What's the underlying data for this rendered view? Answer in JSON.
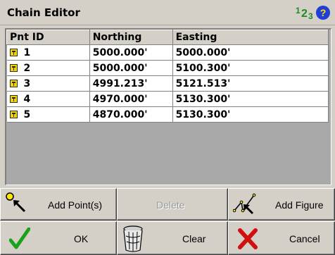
{
  "window": {
    "title": "Chain Editor"
  },
  "header_icons": {
    "numbers": [
      "1",
      "2",
      "3"
    ],
    "help": "?"
  },
  "grid": {
    "columns": [
      "Pnt ID",
      "Northing",
      "Easting"
    ],
    "rows": [
      {
        "id": "1",
        "northing": "5000.000'",
        "easting": "5000.000'"
      },
      {
        "id": "2",
        "northing": "5000.000'",
        "easting": "5100.300'"
      },
      {
        "id": "3",
        "northing": "4991.213'",
        "easting": "5121.513'"
      },
      {
        "id": "4",
        "northing": "4970.000'",
        "easting": "5130.300'"
      },
      {
        "id": "5",
        "northing": "4870.000'",
        "easting": "5130.300'"
      }
    ]
  },
  "buttons": {
    "add_points": "Add Point(s)",
    "delete": "Delete",
    "add_figure": "Add Figure",
    "ok": "OK",
    "clear": "Clear",
    "cancel": "Cancel"
  },
  "colors": {
    "accent_green": "#1f8a1f",
    "help_blue": "#1f3fd6",
    "cancel_red": "#d01010",
    "point_icon": "#f5d500"
  }
}
